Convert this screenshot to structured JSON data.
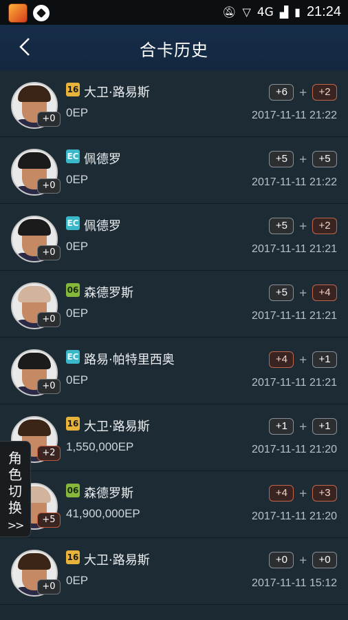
{
  "status": {
    "time": "21:24",
    "network": "4G"
  },
  "header": {
    "title": "合卡历史"
  },
  "rows": [
    {
      "name": "大卫·路易斯",
      "tag": "16",
      "tagStyle": "gold",
      "ep": "0EP",
      "level": "+0",
      "mod1": "+6",
      "mod2": "+2",
      "mod1Warm": false,
      "mod2Warm": true,
      "date": "2017-11-11 21:22",
      "hair": "#3a2517"
    },
    {
      "name": "佩德罗",
      "tag": "EC",
      "tagStyle": "teal",
      "ep": "0EP",
      "level": "+0",
      "mod1": "+5",
      "mod2": "+5",
      "mod1Warm": false,
      "mod2Warm": false,
      "date": "2017-11-11 21:22",
      "hair": "#1b1b1b"
    },
    {
      "name": "佩德罗",
      "tag": "EC",
      "tagStyle": "teal",
      "ep": "0EP",
      "level": "+0",
      "mod1": "+5",
      "mod2": "+2",
      "mod1Warm": false,
      "mod2Warm": true,
      "date": "2017-11-11 21:21",
      "hair": "#1b1b1b"
    },
    {
      "name": "森德罗斯",
      "tag": "06",
      "tagStyle": "green",
      "ep": "0EP",
      "level": "+0",
      "mod1": "+5",
      "mod2": "+4",
      "mod1Warm": false,
      "mod2Warm": true,
      "date": "2017-11-11 21:21",
      "hair": "#d2b49c"
    },
    {
      "name": "路易·帕特里西奥",
      "tag": "EC",
      "tagStyle": "teal",
      "ep": "0EP",
      "level": "+0",
      "mod1": "+4",
      "mod2": "+1",
      "mod1Warm": true,
      "mod2Warm": false,
      "date": "2017-11-11 21:21",
      "hair": "#1b1b1b"
    },
    {
      "name": "大卫·路易斯",
      "tag": "16",
      "tagStyle": "gold",
      "ep": "1,550,000EP",
      "level": "+2",
      "mod1": "+1",
      "mod2": "+1",
      "mod1Warm": false,
      "mod2Warm": false,
      "date": "2017-11-11 21:20",
      "hair": "#3a2517"
    },
    {
      "name": "森德罗斯",
      "tag": "06",
      "tagStyle": "green",
      "ep": "41,900,000EP",
      "level": "+5",
      "mod1": "+4",
      "mod2": "+3",
      "mod1Warm": true,
      "mod2Warm": true,
      "date": "2017-11-11 21:20",
      "hair": "#d2b49c"
    },
    {
      "name": "大卫·路易斯",
      "tag": "16",
      "tagStyle": "gold",
      "ep": "0EP",
      "level": "+0",
      "mod1": "+0",
      "mod2": "+0",
      "mod1Warm": false,
      "mod2Warm": false,
      "date": "2017-11-11 15:12",
      "hair": "#3a2517"
    }
  ],
  "plus_sign": "+",
  "role_switch": {
    "chars": [
      "角",
      "色",
      "切",
      "换"
    ],
    "arrow": ">>"
  }
}
